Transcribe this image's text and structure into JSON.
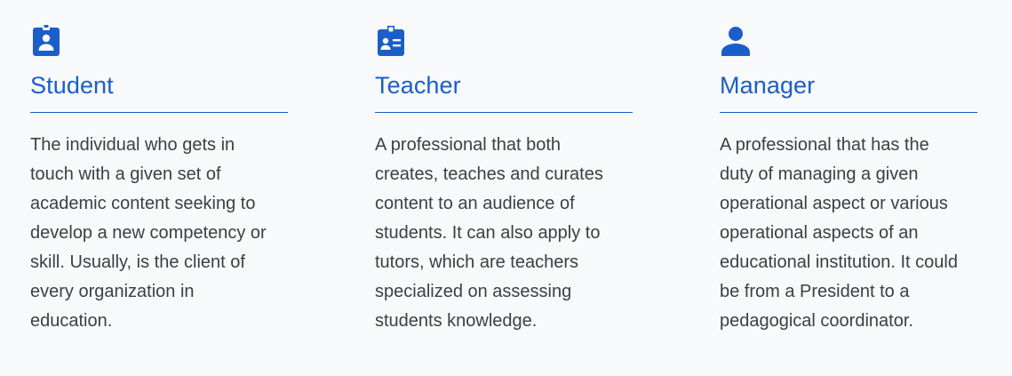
{
  "roles": [
    {
      "icon": "badge-icon",
      "title": "Student",
      "description": "The individual who gets in\ntouch with a given set of\nacademic content seeking to\ndevelop a new competency or\nskill. Usually, is the client of\nevery organization in\neducation."
    },
    {
      "icon": "id-card-icon",
      "title": "Teacher",
      "description": "A professional that both\ncreates, teaches and curates\ncontent to an audience of\nstudents. It can also apply to\ntutors, which are teachers\nspecialized on assessing\nstudents knowledge."
    },
    {
      "icon": "person-icon",
      "title": "Manager",
      "description": "A professional that has the\nduty of managing a given\noperational aspect or various\noperational aspects of an\neducational institution. It could\nbe from a President to a\npedagogical coordinator."
    }
  ],
  "colors": {
    "accent": "#1a5fc8",
    "text": "#3c4043",
    "background": "#f8f9fb"
  }
}
